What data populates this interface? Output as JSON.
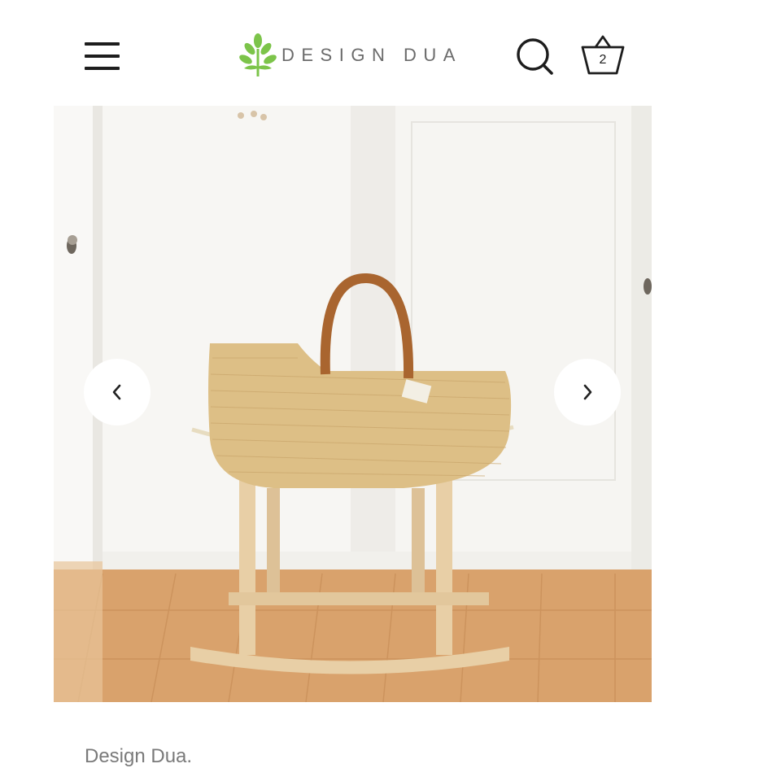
{
  "header": {
    "menu_icon": "hamburger-menu-icon",
    "logo_icon": "leaf-tree-icon",
    "logo_text": "DESIGN DUA",
    "search_icon": "search-icon",
    "cart_icon": "basket-icon",
    "cart_count": "2",
    "logo_color": "#7cc44a"
  },
  "gallery": {
    "image_subject": "woven-moses-basket-on-wooden-rocking-stand",
    "prev_icon": "chevron-left-icon",
    "next_icon": "chevron-right-icon"
  },
  "product": {
    "vendor": "Design Dua."
  }
}
